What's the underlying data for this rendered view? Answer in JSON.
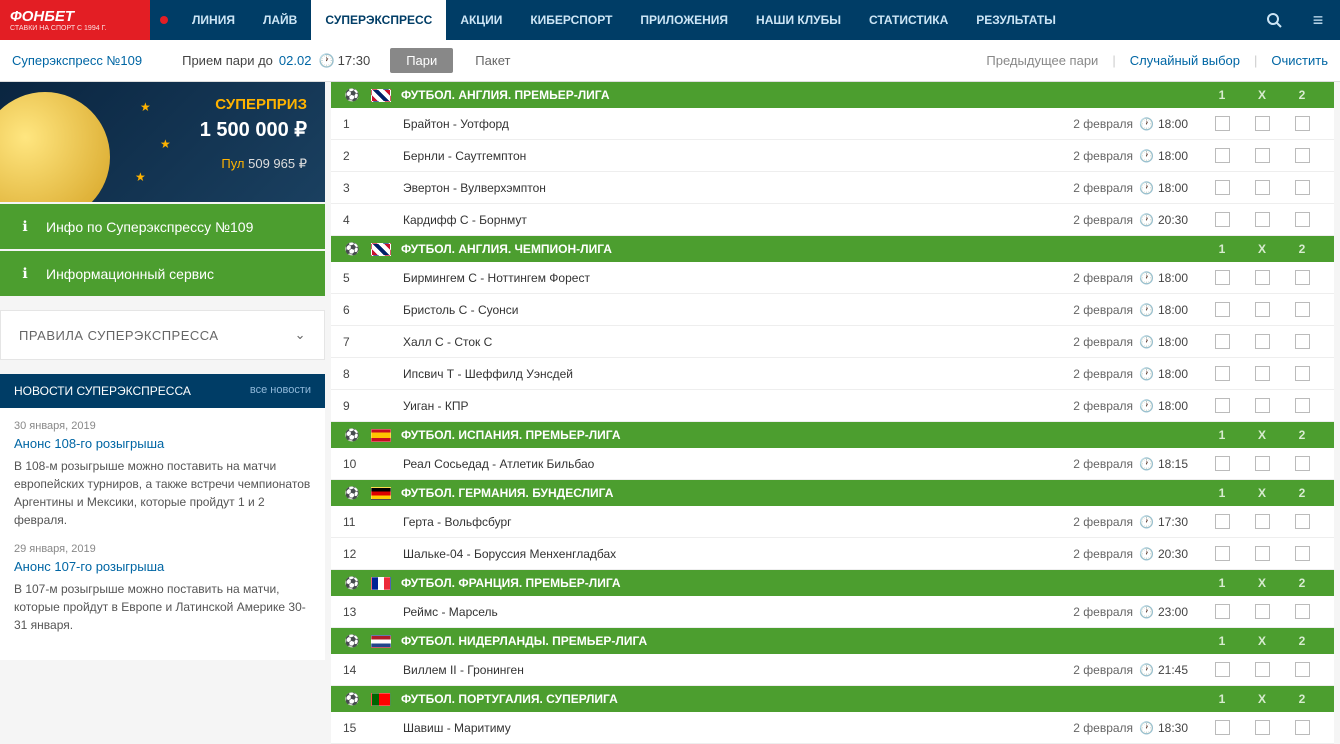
{
  "logo": {
    "main": "ФОНБЕТ",
    "sub": "СТАВКИ НА СПОРТ С 1994 Г."
  },
  "nav": [
    {
      "label": "ЛИНИЯ",
      "active": false
    },
    {
      "label": "ЛАЙВ",
      "active": false
    },
    {
      "label": "СУПЕРЭКСПРЕСС",
      "active": true
    },
    {
      "label": "АКЦИИ",
      "active": false
    },
    {
      "label": "КИБЕРСПОРТ",
      "active": false
    },
    {
      "label": "ПРИЛОЖЕНИЯ",
      "active": false
    },
    {
      "label": "НАШИ КЛУБЫ",
      "active": false
    },
    {
      "label": "СТАТИСТИКА",
      "active": false
    },
    {
      "label": "РЕЗУЛЬТАТЫ",
      "active": false
    }
  ],
  "subbar": {
    "title": "Суперэкспресс №109",
    "deadline_label": "Прием пари до",
    "date": "02.02",
    "time": "17:30",
    "tabs": {
      "pari": "Пари",
      "packet": "Пакет"
    },
    "links": {
      "prev": "Предыдущее пари",
      "random": "Случайный выбор",
      "clear": "Очистить"
    }
  },
  "prize": {
    "label": "СУПЕРПРИЗ",
    "amount": "1 500 000 ₽",
    "pool_label": "Пул",
    "pool_value": "509 965 ₽"
  },
  "green_buttons": {
    "info": "Инфо по Суперэкспрессу №109",
    "service": "Информационный сервис"
  },
  "rules": "ПРАВИЛА СУПЕРЭКСПРЕССА",
  "news_header": {
    "title": "НОВОСТИ СУПЕРЭКСПРЕССА",
    "all": "все новости"
  },
  "news": [
    {
      "date": "30 января, 2019",
      "title": "Анонс 108-го розыгрыша",
      "text": "В 108-м розыгрыше можно поставить на матчи европейских турниров, а также встречи чемпионатов Аргентины и Мексики, которые пройдут 1 и 2 февраля."
    },
    {
      "date": "29 января, 2019",
      "title": "Анонс 107-го розыгрыша",
      "text": "В 107-м розыгрыше можно поставить на матчи, которые пройдут в Европе и Латинской Америке 30-31 января."
    }
  ],
  "bet_headers": [
    "1",
    "X",
    "2"
  ],
  "groups": [
    {
      "league": "ФУТБОЛ. АНГЛИЯ. ПРЕМЬЕР-ЛИГА",
      "flag": "gb",
      "matches": [
        {
          "n": "1",
          "name": "Брайтон - Уотфорд",
          "date": "2 февраля",
          "time": "18:00"
        },
        {
          "n": "2",
          "name": "Бернли - Саутгемптон",
          "date": "2 февраля",
          "time": "18:00"
        },
        {
          "n": "3",
          "name": "Эвертон - Вулверхэмптон",
          "date": "2 февраля",
          "time": "18:00"
        },
        {
          "n": "4",
          "name": "Кардифф С - Борнмут",
          "date": "2 февраля",
          "time": "20:30"
        }
      ]
    },
    {
      "league": "ФУТБОЛ. АНГЛИЯ. ЧЕМПИОН-ЛИГА",
      "flag": "gb",
      "matches": [
        {
          "n": "5",
          "name": "Бирмингем С - Ноттингем Форест",
          "date": "2 февраля",
          "time": "18:00"
        },
        {
          "n": "6",
          "name": "Бристоль С - Суонси",
          "date": "2 февраля",
          "time": "18:00"
        },
        {
          "n": "7",
          "name": "Халл С - Сток С",
          "date": "2 февраля",
          "time": "18:00"
        },
        {
          "n": "8",
          "name": "Ипсвич Т - Шеффилд Уэнсдей",
          "date": "2 февраля",
          "time": "18:00"
        },
        {
          "n": "9",
          "name": "Уиган - КПР",
          "date": "2 февраля",
          "time": "18:00"
        }
      ]
    },
    {
      "league": "ФУТБОЛ. ИСПАНИЯ. ПРЕМЬЕР-ЛИГА",
      "flag": "es",
      "matches": [
        {
          "n": "10",
          "name": "Реал Сосьедад - Атлетик Бильбао",
          "date": "2 февраля",
          "time": "18:15"
        }
      ]
    },
    {
      "league": "ФУТБОЛ. ГЕРМАНИЯ. БУНДЕСЛИГА",
      "flag": "de",
      "matches": [
        {
          "n": "11",
          "name": "Герта - Вольфсбург",
          "date": "2 февраля",
          "time": "17:30"
        },
        {
          "n": "12",
          "name": "Шальке-04 - Боруссия Менхенгладбах",
          "date": "2 февраля",
          "time": "20:30"
        }
      ]
    },
    {
      "league": "ФУТБОЛ. ФРАНЦИЯ. ПРЕМЬЕР-ЛИГА",
      "flag": "fr",
      "matches": [
        {
          "n": "13",
          "name": "Реймс - Марсель",
          "date": "2 февраля",
          "time": "23:00"
        }
      ]
    },
    {
      "league": "ФУТБОЛ. НИДЕРЛАНДЫ. ПРЕМЬЕР-ЛИГА",
      "flag": "nl",
      "matches": [
        {
          "n": "14",
          "name": "Виллем II - Гронинген",
          "date": "2 февраля",
          "time": "21:45"
        }
      ]
    },
    {
      "league": "ФУТБОЛ. ПОРТУГАЛИЯ. СУПЕРЛИГА",
      "flag": "pt",
      "matches": [
        {
          "n": "15",
          "name": "Шавиш - Маритиму",
          "date": "2 февраля",
          "time": "18:30"
        }
      ]
    }
  ]
}
